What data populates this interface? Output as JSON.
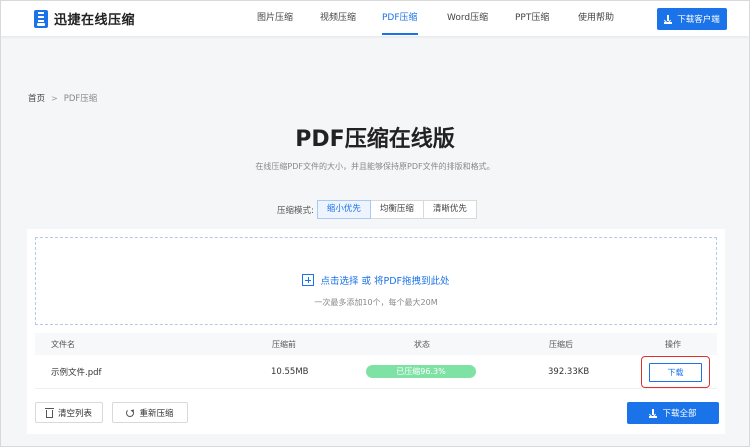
{
  "header": {
    "brand": "迅捷在线压缩",
    "nav": [
      {
        "label": "图片压缩",
        "active": false
      },
      {
        "label": "视频压缩",
        "active": false
      },
      {
        "label": "PDF压缩",
        "active": true
      },
      {
        "label": "Word压缩",
        "active": false
      },
      {
        "label": "PPT压缩",
        "active": false
      },
      {
        "label": "使用帮助",
        "active": false
      }
    ],
    "client_button": "下载客户端"
  },
  "breadcrumb": {
    "home": "首页",
    "separator": ">",
    "current": "PDF压缩"
  },
  "main": {
    "title": "PDF压缩在线版",
    "subtitle": "在线压缩PDF文件的大小，并且能够保持原PDF文件的排版和格式。"
  },
  "mode": {
    "label": "压缩模式:",
    "options": [
      "缩小优先",
      "均衡压缩",
      "清晰优先"
    ],
    "selected": "缩小优先"
  },
  "dropzone": {
    "main_text": "点击选择 或 将PDF拖拽到此处",
    "hint": "一次最多添加10个，每个最大20M"
  },
  "table": {
    "headers": [
      "文件名",
      "压缩前",
      "状态",
      "压缩后",
      "操作"
    ],
    "rows": [
      {
        "name": "示例文件.pdf",
        "before": "10.55MB",
        "status": "已压缩96.3%",
        "progress": 1.0,
        "after": "392.33KB",
        "action": "下载"
      }
    ]
  },
  "footer": {
    "clear": "清空列表",
    "recompress": "重新压缩",
    "download_all": "下载全部"
  },
  "colors": {
    "accent": "#1a73e8",
    "success": "#7ee2a4",
    "highlight": "#e0302e"
  }
}
